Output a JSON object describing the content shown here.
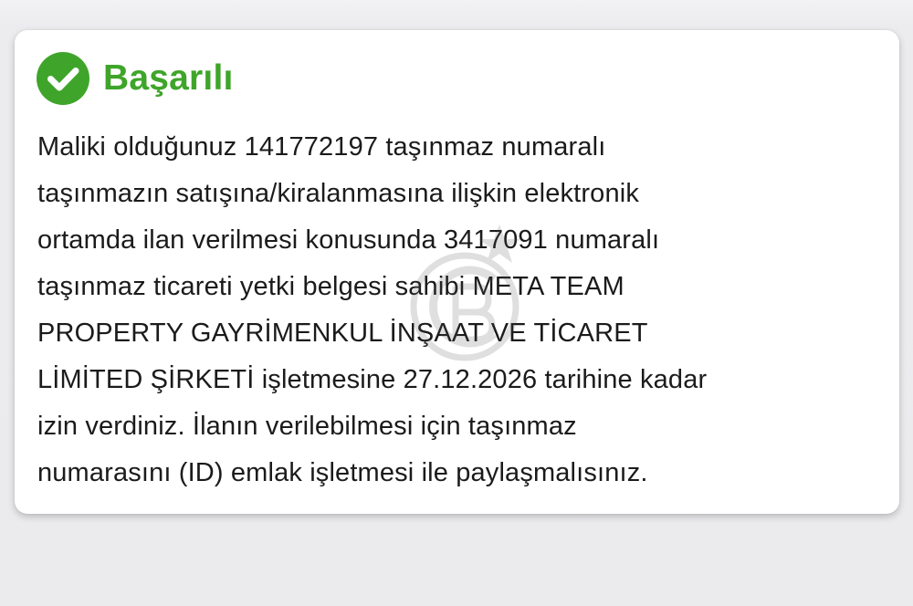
{
  "colors": {
    "success_green": "#3fa52a",
    "text": "#1b1b1b",
    "card_background": "#ffffff",
    "page_background": "#ebebee"
  },
  "alert": {
    "icon": "check-circle-icon",
    "title": "Başarılı",
    "message_lines": [
      "Maliki olduğunuz 141772197 taşınmaz numaralı",
      "taşınmazın satışına/kiralanmasına ilişkin elektronik",
      "ortamda ilan verilmesi konusunda 3417091 numaralı",
      "taşınmaz ticareti yetki belgesi sahibi META TEAM",
      "PROPERTY GAYRİMENKUL İNŞAAT VE TİCARET",
      "LİMİTED ŞİRKETİ işletmesine 27.12.2026 tarihine kadar",
      "izin verdiniz. İlanın verilebilmesi için taşınmaz",
      "numarasını (ID) emlak işletmesi ile paylaşmalısınız."
    ]
  }
}
